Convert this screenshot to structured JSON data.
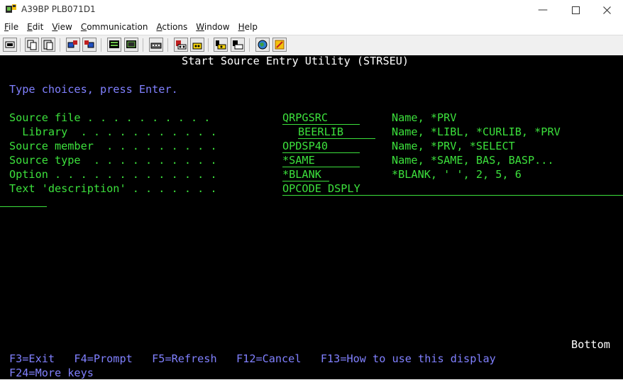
{
  "window": {
    "title": "A39BP PLB071D1"
  },
  "menu": [
    {
      "pre": "",
      "key": "F",
      "post": "ile"
    },
    {
      "pre": "",
      "key": "E",
      "post": "dit"
    },
    {
      "pre": "",
      "key": "V",
      "post": "iew"
    },
    {
      "pre": "",
      "key": "C",
      "post": "ommunication"
    },
    {
      "pre": "",
      "key": "A",
      "post": "ctions"
    },
    {
      "pre": "",
      "key": "W",
      "post": "indow"
    },
    {
      "pre": "",
      "key": "H",
      "post": "elp"
    }
  ],
  "screen": {
    "heading": "Start Source Entry Utility (STRSEU)",
    "instruction": "Type choices, press Enter.",
    "rows": [
      {
        "label": "Source file . . . . . . . . . .",
        "value": "QRPGSRC",
        "hint": "Name, *PRV"
      },
      {
        "label": "  Library  . . . . . . . . . . .",
        "value": "BEERLIB",
        "hint": "Name, *LIBL, *CURLIB, *PRV"
      },
      {
        "label": "Source member  . . . . . . . . .",
        "value": "OPDSP40",
        "hint": "Name, *PRV, *SELECT"
      },
      {
        "label": "Source type  . . . . . . . . . .",
        "value": "*SAME",
        "hint": "Name, *SAME, BAS, BASP..."
      },
      {
        "label": "Option . . . . . . . . . . . . .",
        "value": "*BLANK",
        "hint": "*BLANK, ' ', 2, 5, 6"
      },
      {
        "label": "Text 'description' . . . . . . .",
        "value": "OPCODE DSPLY",
        "hint": ""
      }
    ],
    "bottom_marker": "Bottom",
    "fkeys_line1": "F3=Exit   F4=Prompt   F5=Refresh   F12=Cancel   F13=How to use this display",
    "fkeys_line2": "F24=More keys"
  },
  "colors": {
    "field": "#3ce03c",
    "heading": "#ffffff",
    "keys": "#8080ff",
    "background": "#000000"
  },
  "icons": [
    "app-icon",
    "minimize-icon",
    "maximize-icon",
    "close-icon"
  ]
}
